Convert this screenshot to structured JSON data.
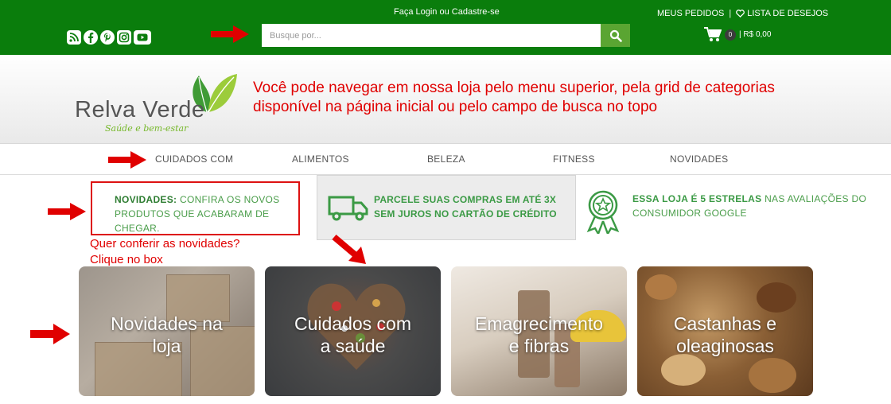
{
  "topbar": {
    "login_text": "Faça Login ou Cadastre-se",
    "my_orders": "MEUS PEDIDOS",
    "separator": "|",
    "wishlist": "LISTA DE DESEJOS",
    "cart_count": "0",
    "cart_total": "| R$ 0,00",
    "social_icons": [
      "rss-icon",
      "facebook-icon",
      "pinterest-icon",
      "instagram-icon",
      "youtube-icon"
    ]
  },
  "search": {
    "placeholder": "Busque por..."
  },
  "logo": {
    "name": "Relva Verde",
    "tagline": "Saúde e bem-estar"
  },
  "annotation": {
    "main": "Você pode navegar em nossa loja pelo menu superior, pela grid de categorias disponível na página inicial ou pelo campo de busca no topo",
    "novidades_note_line1": "Quer conferir as novidades?",
    "novidades_note_line2": "Clique no box"
  },
  "nav": {
    "items": [
      "CUIDADOS COM",
      "ALIMENTOS",
      "BELEZA",
      "FITNESS",
      "NOVIDADES"
    ]
  },
  "info": {
    "novidades_bold": "NOVIDADES:",
    "novidades_text": "CONFIRA OS NOVOS PRODUTOS QUE ACABARAM DE CHEGAR.",
    "parcel_line1": "PARCELE SUAS COMPRAS EM ATÉ 3X",
    "parcel_line2": "SEM JUROS NO CARTÃO DE CRÉDITO",
    "stars_bold": "ESSA LOJA É 5 ESTRELAS",
    "stars_text": "NAS AVALIAÇÕES DO CONSUMIDOR GOOGLE"
  },
  "categories": [
    {
      "line1": "Novidades na",
      "line2": "loja"
    },
    {
      "line1": "Cuidados com",
      "line2": "a saúde"
    },
    {
      "line1": "Emagrecimento",
      "line2": "e fibras"
    },
    {
      "line1": "Castanhas e",
      "line2": "oleaginosas"
    }
  ],
  "colors": {
    "topbar_green": "#0a7d0c",
    "accent_green": "#5aa532",
    "annotation_red": "#e00000",
    "info_green": "#3b9a45"
  }
}
